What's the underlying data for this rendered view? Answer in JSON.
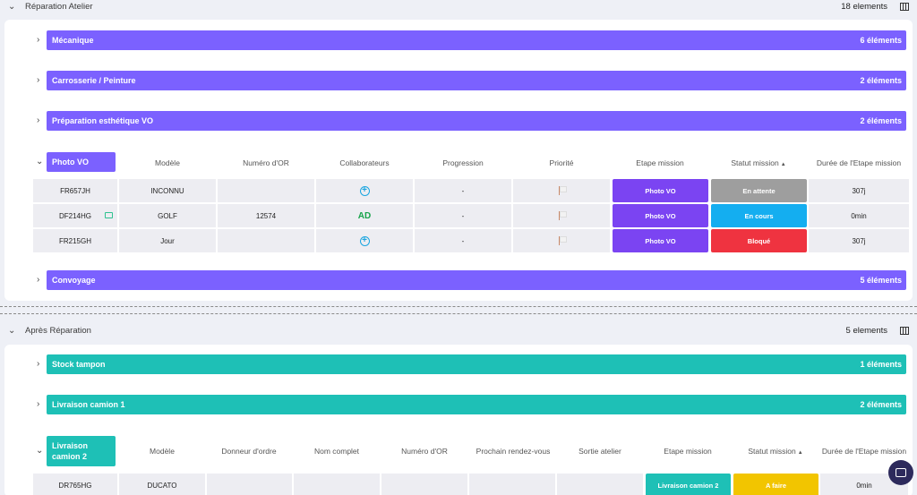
{
  "sections": [
    {
      "title": "Réparation Atelier",
      "count": "18 elements"
    },
    {
      "title": "Après Réparation",
      "count": "5 elements"
    }
  ],
  "groups_atelier": [
    {
      "label": "Mécanique",
      "count": "6 éléments"
    },
    {
      "label": "Carrosserie / Peinture",
      "count": "2 éléments"
    },
    {
      "label": "Préparation esthétique VO",
      "count": "2 éléments"
    },
    {
      "label": "Convoyage",
      "count": "5 éléments"
    }
  ],
  "photo_vo": {
    "tab": "Photo VO",
    "columns": [
      "Modèle",
      "Numéro d'OR",
      "Collaborateurs",
      "Progression",
      "Priorité",
      "Etape mission",
      "Statut mission",
      "Durée de l'Etape mission"
    ],
    "rows": [
      {
        "plate": "FR657JH",
        "model": "INCONNU",
        "or": "",
        "collab": "+",
        "progress": "-",
        "step": "Photo VO",
        "status": "En attente",
        "status_color": "#9e9e9e",
        "duration": "307j"
      },
      {
        "plate": "DF214HG",
        "model": "GOLF",
        "or": "12574",
        "collab": "AD",
        "progress": "-",
        "step": "Photo VO",
        "status": "En cours",
        "status_color": "#14aef0",
        "duration": "0min"
      },
      {
        "plate": "FR215GH",
        "model": "Jour",
        "or": "",
        "collab": "+",
        "progress": "-",
        "step": "Photo VO",
        "status": "Bloqué",
        "status_color": "#ef3340",
        "duration": "307j"
      }
    ]
  },
  "groups_apres": [
    {
      "label": "Stock tampon",
      "count": "1 éléments"
    },
    {
      "label": "Livraison camion 1",
      "count": "2 éléments"
    }
  ],
  "camion2": {
    "tab_line1": "Livraison",
    "tab_line2": "camion 2",
    "columns": [
      "Modèle",
      "Donneur d'ordre",
      "Nom complet",
      "Numéro d'OR",
      "Prochain rendez-vous",
      "Sortie atelier",
      "Etape mission",
      "Statut mission",
      "Durée de l'Etape mission"
    ],
    "rows": [
      {
        "plate": "DR765HG",
        "model": "DUCATO",
        "step": "Livraison camion 2",
        "status": "A faire",
        "status_color": "#f2c500",
        "duration": "0min"
      }
    ]
  },
  "colors": {
    "purple": "#7b61ff",
    "teal": "#1ec0b6",
    "step_purple": "#7b44f2",
    "step_teal": "#1ec0b6"
  }
}
